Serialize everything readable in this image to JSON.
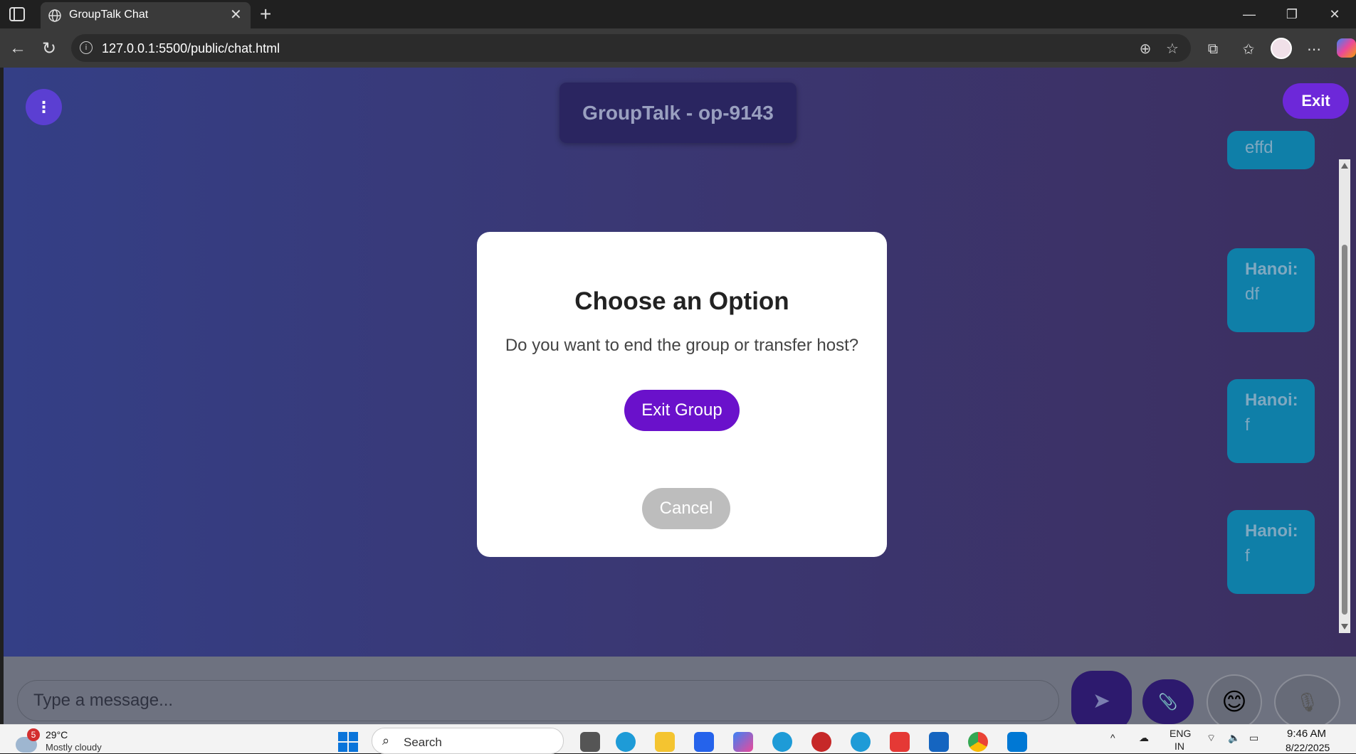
{
  "browser": {
    "tab_title": "GroupTalk Chat",
    "tab_close": "✕",
    "new_tab": "+",
    "url": "127.0.0.1:5500/public/chat.html",
    "window_minimize": "—",
    "window_restore": "❐",
    "window_close": "✕"
  },
  "app": {
    "menu_icon": "⋮",
    "title": "GroupTalk - op-9143",
    "exit_label": "Exit",
    "messages": [
      {
        "sender": "",
        "text": "effd"
      },
      {
        "sender": "Hanoi:",
        "text": "df"
      },
      {
        "sender": "Hanoi:",
        "text": "f"
      },
      {
        "sender": "Hanoi:",
        "text": "f"
      }
    ]
  },
  "modal": {
    "title": "Choose an Option",
    "text": "Do you want to end the group or transfer host?",
    "exit_group_label": "Exit Group",
    "cancel_label": "Cancel"
  },
  "composer": {
    "placeholder": "Type a message...",
    "send_icon": "➤",
    "attach_icon": "📎",
    "emoji_icon": "😊",
    "mic_icon": "🎙"
  },
  "taskbar": {
    "weather_badge": "5",
    "weather_temp": "29°C",
    "weather_desc": "Mostly cloudy",
    "search_placeholder": "Search",
    "language": "ENG",
    "language_region": "IN",
    "time": "9:46 AM",
    "date": "8/22/2025"
  },
  "colors": {
    "accent_purple": "#6a11cb",
    "message_bubble": "#0f7fa8",
    "background_start": "#343f86",
    "background_end": "#3c2f60"
  }
}
